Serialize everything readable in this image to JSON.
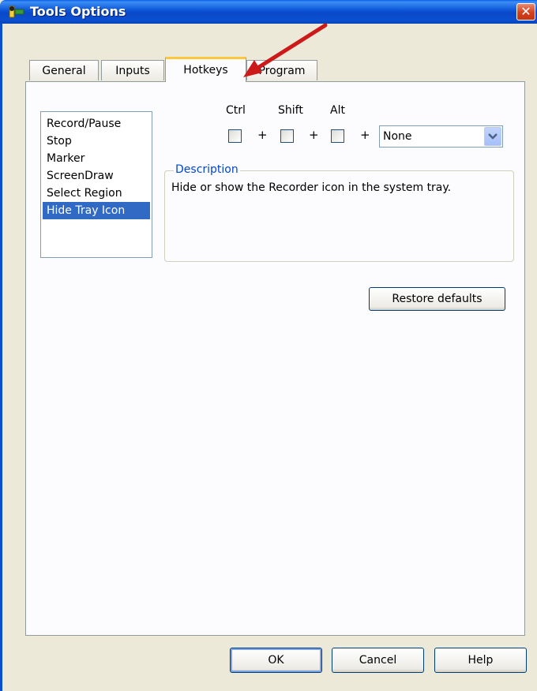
{
  "window": {
    "title": "Tools Options",
    "close_label": "✕"
  },
  "tabs": [
    {
      "label": "General"
    },
    {
      "label": "Inputs"
    },
    {
      "label": "Hotkeys",
      "active": true
    },
    {
      "label": "Program"
    }
  ],
  "hotkey_actions": [
    {
      "label": "Record/Pause"
    },
    {
      "label": "Stop"
    },
    {
      "label": "Marker"
    },
    {
      "label": "ScreenDraw"
    },
    {
      "label": "Select Region"
    },
    {
      "label": "Hide Tray Icon",
      "selected": true
    }
  ],
  "modifiers": {
    "ctrl_label": "Ctrl",
    "shift_label": "Shift",
    "alt_label": "Alt",
    "plus": "+"
  },
  "key_select": {
    "value": "None"
  },
  "description": {
    "legend": "Description",
    "text": "Hide or show the Recorder icon in the system tray."
  },
  "buttons": {
    "restore_defaults": "Restore defaults",
    "ok": "OK",
    "cancel": "Cancel",
    "help": "Help"
  },
  "colors": {
    "selection": "#316ac5",
    "titlebar": "#0a53d6",
    "annotation_arrow": "#cc1a1a",
    "active_tab_accent": "#ffc83c"
  }
}
